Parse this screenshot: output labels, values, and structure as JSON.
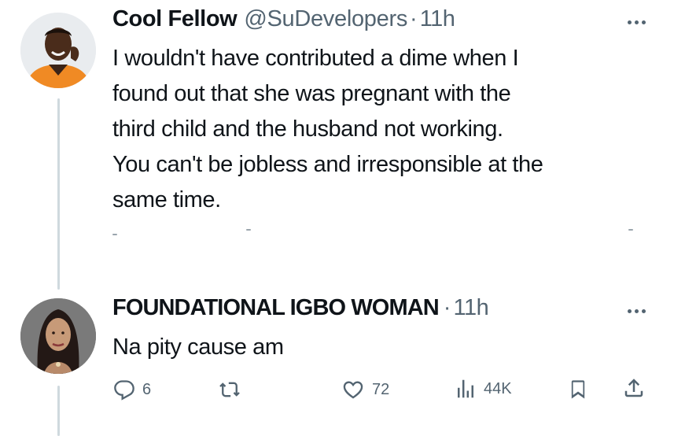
{
  "tweets": [
    {
      "display_name": "Cool Fellow",
      "handle": "@SuDevelopers",
      "separator": "·",
      "time": "11h",
      "text_lines": [
        "I wouldn't have contributed a dime when I",
        "found out that she was pregnant with the",
        "third child and the husband not working.",
        "You can't be jobless and irresponsible at the",
        "same time."
      ],
      "avatar_icon": "avatar-young-man-orange-shirt"
    },
    {
      "display_name": "FOUNDATIONAL IGBO WOMAN",
      "separator": "·",
      "time": "11h",
      "text": "Na pity cause am",
      "avatar_icon": "avatar-woman-portrait",
      "actions": {
        "reply_count": "6",
        "retweet_count": "",
        "like_count": "72",
        "views_count": "44K"
      }
    }
  ],
  "colors": {
    "text_primary": "#0f1419",
    "text_secondary": "#536471",
    "thread_line": "#cfd9de"
  },
  "icons": [
    "more-icon",
    "reply-icon",
    "retweet-icon",
    "like-icon",
    "views-icon",
    "bookmark-icon",
    "share-icon"
  ]
}
